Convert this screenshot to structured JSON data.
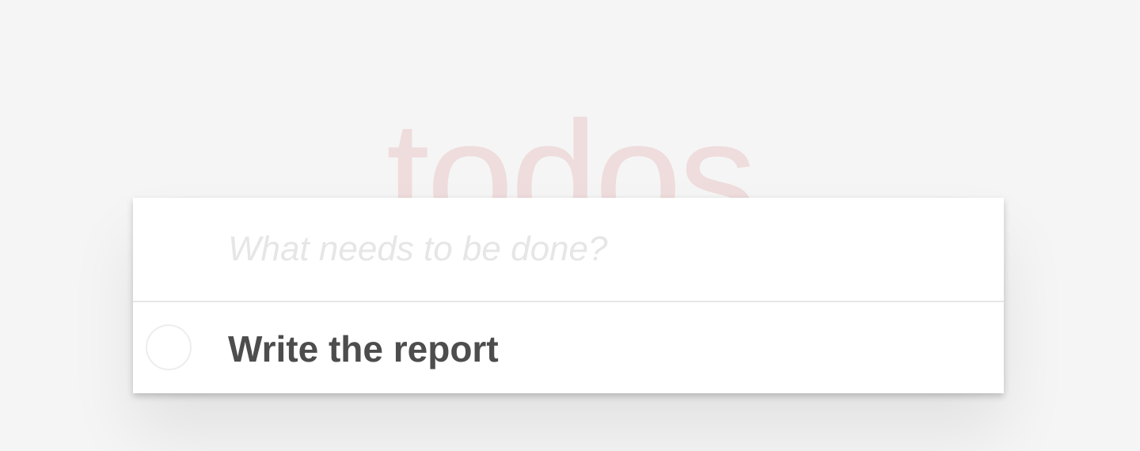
{
  "header": {
    "title": "todos"
  },
  "new_todo": {
    "value": "",
    "placeholder": "What needs to be done?"
  },
  "todos": [
    {
      "label": "Write the report",
      "completed": false
    }
  ],
  "colors": {
    "title": "#efdcdc",
    "text": "#4d4d4d",
    "background": "#f5f5f5"
  }
}
